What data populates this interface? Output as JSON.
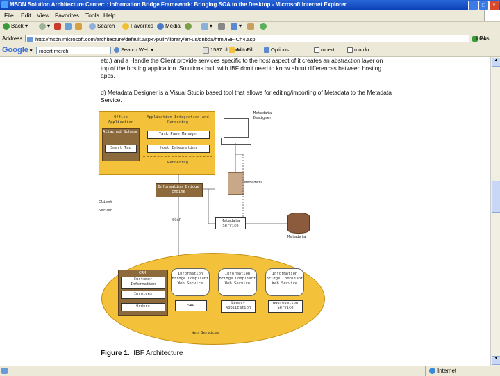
{
  "window": {
    "title": "MSDN Solution Architecture Center: : Information Bridge Framework: Bringing SOA to the Desktop - Microsoft Internet Explorer",
    "controls": {
      "minimize": "_",
      "maximize": "□",
      "close": "×"
    }
  },
  "menu": [
    "File",
    "Edit",
    "View",
    "Favorites",
    "Tools",
    "Help"
  ],
  "toolbar": {
    "back": "Back",
    "forward": "",
    "search": "Search",
    "favorites": "Favorites",
    "media": "Media",
    "icons": [
      "back-icon",
      "forward-icon",
      "stop-icon",
      "refresh-icon",
      "home-icon",
      "search-icon",
      "favorites-icon",
      "media-icon",
      "history-icon",
      "mail-icon",
      "print-icon",
      "edit-icon",
      "discuss-icon",
      "messenger-icon"
    ]
  },
  "address": {
    "label": "Address",
    "url": "http://msdn.microsoft.com/architecture/default.aspx?pull=/library/en-us/dnbda/html/IBF-Ch4.asp",
    "go": "Go",
    "links": "Links"
  },
  "googlebar": {
    "logo": "Google",
    "query": "robert merch",
    "search_web": "Search Web",
    "blocked": "1587 blocked",
    "autofill": "AutoFill",
    "options": "Options",
    "term1": "robert",
    "term2": "murdo"
  },
  "article": {
    "para1_line1": "etc.) and a Handle the Client provide services specific to the host aspect of it creates an abstraction layer on",
    "para1_line2": "top of the hosting application. Solutions built with IBF don't need to know about differences between hosting",
    "para1_line3": "apps.",
    "para2_line1": "d) Metadata Designer is a Visual Studio based tool that allows for editing/importing of Metadata to the Metadata",
    "para2_line2": "Service.",
    "caption_prefix": "Figure 1.",
    "caption_text": "IBF Architecture"
  },
  "diagram": {
    "office_app": "Office Application",
    "attached_schema": "Attached Schema",
    "smart_tag": "Smart Tag",
    "integration_rendering": "Application Integration and Rendering",
    "task_pane_manager": "Task Pane Manager",
    "host_integration": "Host Integration",
    "rendering": "Rendering",
    "ibf_engine": "Information Bridge Engine",
    "metadata_designer": "Metadata Designer",
    "metadata_file": "Metadata",
    "client": "Client",
    "server": "Server",
    "soap": "SOAP",
    "metadata_service": "Metadata Service",
    "metadata_db": "Metadata",
    "crm": "CRM",
    "customer_info": "Customer Information",
    "invoices": "Invoices",
    "orders": "Orders",
    "ws1": "Information Bridge Compliant Web Service",
    "ws2": "Information Bridge Compliant Web Service",
    "ws3": "Information Bridge Compliant Web Service",
    "sap": "SAP",
    "legacy": "Legacy Application",
    "aggregation": "Aggregation Service",
    "web_services": "Web Services"
  },
  "status": {
    "zone": "Internet"
  },
  "colors": {
    "accent_yellow": "#f3c23a",
    "title_blue": "#0a3fb6",
    "chrome": "#ece9d8"
  }
}
